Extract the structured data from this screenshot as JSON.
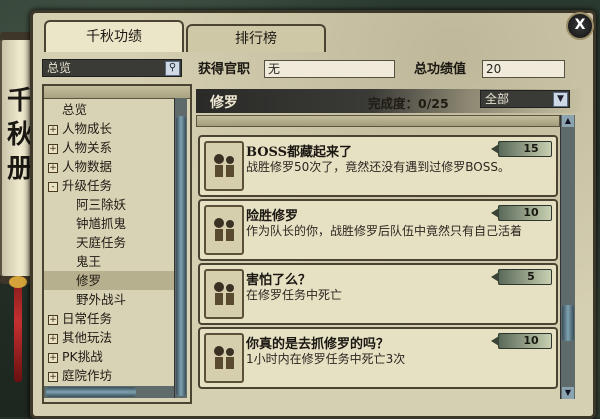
{
  "window": {
    "scroll_title": "千秋册",
    "close_label": "X"
  },
  "tabs": {
    "active": "千秋功绩",
    "inactive": "排行榜"
  },
  "search": {
    "value": "总览"
  },
  "tree": [
    {
      "label": "总览",
      "level": 0,
      "expandable": false,
      "selected": false
    },
    {
      "label": "人物成长",
      "level": 0,
      "expandable": true,
      "expanded": false,
      "selected": false
    },
    {
      "label": "人物关系",
      "level": 0,
      "expandable": true,
      "expanded": false,
      "selected": false
    },
    {
      "label": "人物数据",
      "level": 0,
      "expandable": true,
      "expanded": false,
      "selected": false
    },
    {
      "label": "升级任务",
      "level": 0,
      "expandable": true,
      "expanded": true,
      "selected": false
    },
    {
      "label": "阿三除妖",
      "level": 1,
      "expandable": false,
      "selected": false
    },
    {
      "label": "钟馗抓鬼",
      "level": 1,
      "expandable": false,
      "selected": false
    },
    {
      "label": "天庭任务",
      "level": 1,
      "expandable": false,
      "selected": false
    },
    {
      "label": "鬼王",
      "level": 1,
      "expandable": false,
      "selected": false
    },
    {
      "label": "修罗",
      "level": 1,
      "expandable": false,
      "selected": true
    },
    {
      "label": "野外战斗",
      "level": 1,
      "expandable": false,
      "selected": false
    },
    {
      "label": "日常任务",
      "level": 0,
      "expandable": true,
      "expanded": false,
      "selected": false
    },
    {
      "label": "其他玩法",
      "level": 0,
      "expandable": true,
      "expanded": false,
      "selected": false
    },
    {
      "label": "PK挑战",
      "level": 0,
      "expandable": true,
      "expanded": false,
      "selected": false
    },
    {
      "label": "庭院作坊",
      "level": 0,
      "expandable": true,
      "expanded": false,
      "selected": false
    }
  ],
  "header": {
    "title_label": "获得官职",
    "title_value": "无",
    "score_label": "总功绩值",
    "score_value": "20"
  },
  "category": {
    "name": "修罗",
    "progress_text": "完成度：0/25",
    "filter_value": "全部"
  },
  "achievements": [
    {
      "title": "BOSS都藏起来了",
      "points": "15",
      "desc": "战胜修罗50次了，竟然还没有遇到过修罗BOSS。"
    },
    {
      "title": "险胜修罗",
      "points": "10",
      "desc": "作为队长的你，战胜修罗后队伍中竟然只有自己活着"
    },
    {
      "title": "害怕了么？",
      "points": "5",
      "desc": "在修罗任务中死亡"
    },
    {
      "title": "你真的是去抓修罗的吗？",
      "points": "10",
      "desc": "1小时内在修罗任务中死亡3次"
    }
  ],
  "colors": {
    "panel": "#d6d0b2",
    "card": "#e7e1c4",
    "border": "#4a4331",
    "dark_bar": "#2a2a28"
  }
}
